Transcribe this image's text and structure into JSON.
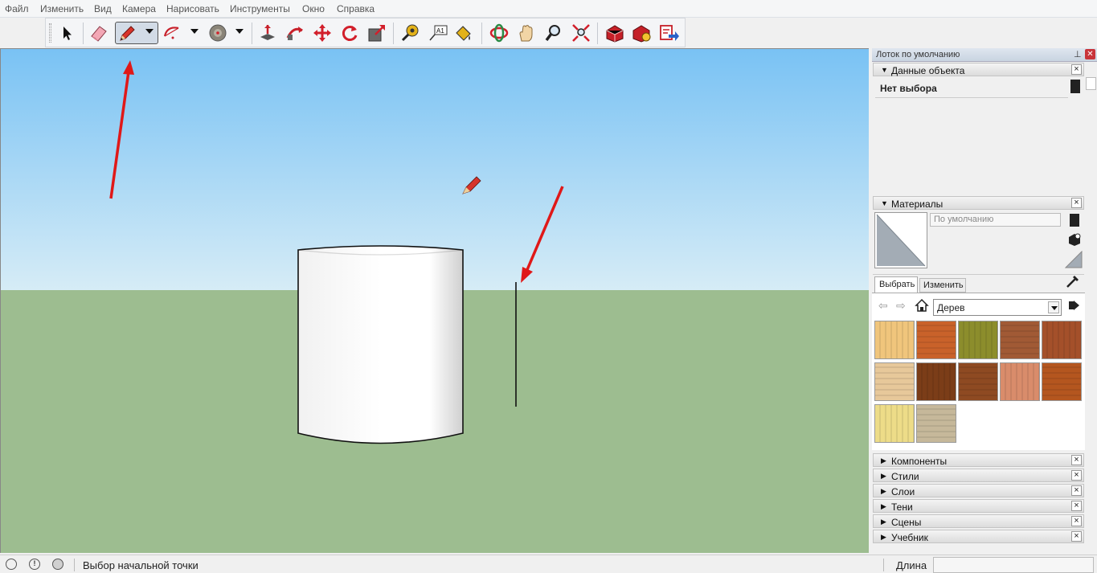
{
  "menu": {
    "items": [
      "Файл",
      "Изменить",
      "Вид",
      "Камера",
      "Нарисовать",
      "Инструменты",
      "Окно",
      "Справка"
    ]
  },
  "toolbar": {
    "tools": [
      "select-tool",
      "eraser-tool",
      "pencil-tool",
      "arc-tool",
      "shapes-tool",
      "push-pull-tool",
      "follow-me-tool",
      "move-tool",
      "rotate-tool",
      "scale-tool",
      "tape-measure-tool",
      "text-tool",
      "paint-bucket-tool",
      "orbit-tool",
      "pan-tool",
      "zoom-tool",
      "zoom-extents-tool",
      "warehouse-tool",
      "extension-warehouse-tool",
      "send-to-layout-tool"
    ],
    "active_tool": "pencil-tool"
  },
  "tray": {
    "title": "Лоток по умолчанию",
    "entity_info": {
      "title": "Данные объекта",
      "selection_text": "Нет выбора"
    },
    "materials": {
      "title": "Материалы",
      "material_name": "По умолчанию",
      "tab_select": "Выбрать",
      "tab_edit": "Изменить",
      "collection": "Дерев",
      "swatch_colors": [
        "#f0c57c",
        "#c9622a",
        "#8c8d2c",
        "#a15a35",
        "#a4502a",
        "#e7c89a",
        "#7b3d18",
        "#8e4a22",
        "#d98c6b",
        "#b4561f",
        "#eddc88",
        "#c6b89a"
      ]
    },
    "collapsed_panels": [
      "Компоненты",
      "Стили",
      "Слои",
      "Тени",
      "Сцены",
      "Учебник"
    ]
  },
  "status": {
    "hint": "Выбор начальной точки",
    "measure_label": "Длина",
    "measure_value": ""
  },
  "colors": {
    "sky_top": "#79c2f4",
    "sky_bottom": "#d6ecf6",
    "ground": "#9dbd90",
    "annotation_arrow": "#e01818"
  }
}
